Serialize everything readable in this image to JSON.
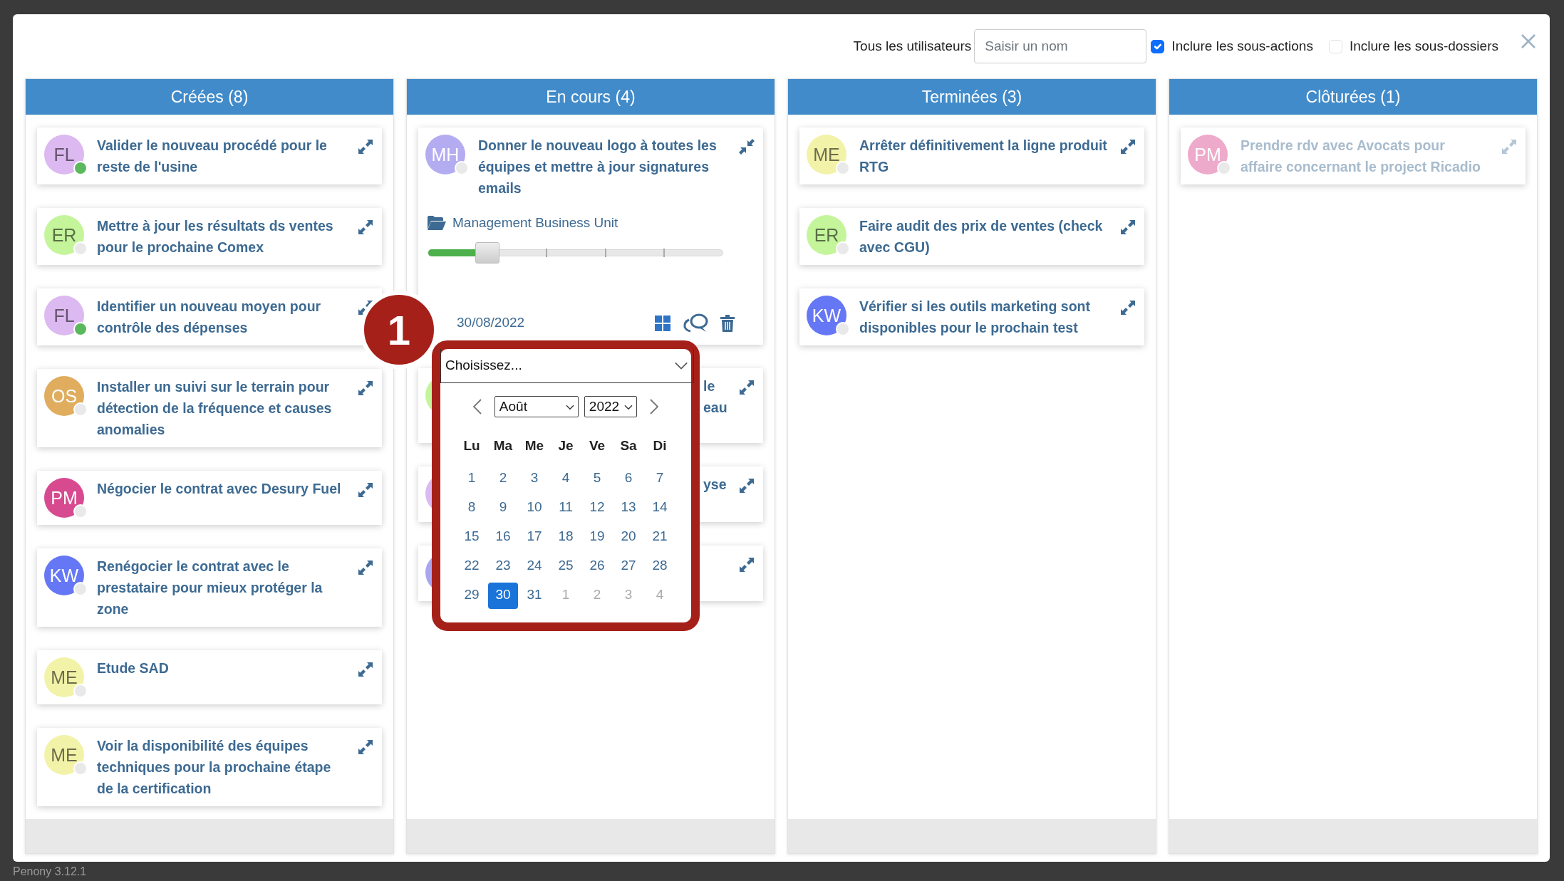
{
  "toolbar": {
    "user_label": "Tous les utilisateurs",
    "user_search": {
      "placeholder": "Saisir un nom"
    },
    "options": [
      {
        "label": "Inclure les sous-actions",
        "checked": true
      },
      {
        "label": "Inclure les sous-dossiers",
        "checked": false
      }
    ]
  },
  "columns": [
    {
      "title": "Créées (8)",
      "cards": [
        {
          "kind": "task",
          "initials": "FL",
          "color": "#dcb9f1",
          "online": true,
          "title": "Valider le nouveau procédé pour le reste de l'usine",
          "expanded": false,
          "muted": false
        },
        {
          "kind": "task",
          "initials": "ER",
          "color": "#c5f59b",
          "online": false,
          "title": "Mettre à jour les résultats ds ventes pour le prochaine Comex",
          "expanded": false,
          "muted": false
        },
        {
          "kind": "task",
          "initials": "FL",
          "color": "#dcb9f1",
          "online": true,
          "title": "Identifier un nouveau moyen pour contrôle des dépenses",
          "expanded": false,
          "muted": false
        },
        {
          "kind": "task",
          "initials": "OS",
          "color": "#dfad5d",
          "online": false,
          "title": "Installer un suivi sur le terrain pour détection de la fréquence et causes anomalies",
          "expanded": false,
          "muted": false
        },
        {
          "kind": "task",
          "initials": "PM",
          "color": "#d84a90",
          "online": false,
          "title": "Négocier le contrat avec Desury Fuel",
          "expanded": false,
          "muted": false
        },
        {
          "kind": "task",
          "initials": "KW",
          "color": "#6677f6",
          "online": false,
          "title": "Renégocier le contrat avec le prestataire pour mieux protéger la zone",
          "expanded": false,
          "muted": false
        },
        {
          "kind": "task",
          "initials": "ME",
          "color": "#f2f3a8",
          "online": false,
          "title": "Etude SAD",
          "expanded": false,
          "muted": false
        },
        {
          "kind": "task",
          "initials": "ME",
          "color": "#f2f3a8",
          "online": false,
          "title": "Voir la disponibilité des équipes techniques pour la prochaine étape de la certification",
          "expanded": false,
          "muted": false
        }
      ]
    },
    {
      "title": "En cours (4)",
      "cards": [
        {
          "kind": "task",
          "initials": "MH",
          "color": "#b3acf0",
          "online": false,
          "title": "Donner le nouveau logo à toutes les équipes et mettre à jour signatures emails",
          "expanded": true,
          "muted": false,
          "folder": "Management Business Unit",
          "progress": {
            "level": 0.2
          },
          "due_date": "30/08/2022"
        },
        {
          "kind": "covered",
          "color": "#c5f59b",
          "visible_lines": [
            "le",
            "eau"
          ],
          "expanded": false,
          "muted": false
        },
        {
          "kind": "covered",
          "color": "#dcb9f1",
          "visible_lines": [
            "yse"
          ],
          "expanded": false,
          "muted": false
        },
        {
          "kind": "covered",
          "color": "#a9a5ef",
          "expanded": false,
          "muted": false
        }
      ]
    },
    {
      "title": "Terminées (3)",
      "cards": [
        {
          "kind": "task",
          "initials": "ME",
          "color": "#f2f3a8",
          "online": false,
          "title": "Arrêter définitivement la ligne produit RTG",
          "expanded": false,
          "muted": false
        },
        {
          "kind": "task",
          "initials": "ER",
          "color": "#c5f59b",
          "online": false,
          "title": "Faire audit des prix de ventes (check avec CGU)",
          "expanded": false,
          "muted": false
        },
        {
          "kind": "task",
          "initials": "KW",
          "color": "#6677f6",
          "online": false,
          "title": "Vérifier si les outils marketing sont disponibles pour le prochain test",
          "expanded": false,
          "muted": false
        }
      ]
    },
    {
      "title": "Clôturées (1)",
      "cards": [
        {
          "kind": "task",
          "initials": "PM",
          "color": "#eeaacb",
          "online": false,
          "title": "Prendre rdv avec Avocats pour affaire concernant le project Ricadio",
          "expanded": false,
          "muted": true
        }
      ]
    }
  ],
  "callout": {
    "number": "1"
  },
  "date_picker": {
    "preset": {
      "value": "Choisissez..."
    },
    "month": "Août",
    "year": "2022",
    "weekdays": [
      "Lu",
      "Ma",
      "Me",
      "Je",
      "Ve",
      "Sa",
      "Di"
    ],
    "weeks": [
      [
        {
          "day": "1",
          "selected": false,
          "outside": false
        },
        {
          "day": "2",
          "selected": false,
          "outside": false
        },
        {
          "day": "3",
          "selected": false,
          "outside": false
        },
        {
          "day": "4",
          "selected": false,
          "outside": false
        },
        {
          "day": "5",
          "selected": false,
          "outside": false
        },
        {
          "day": "6",
          "selected": false,
          "outside": false
        },
        {
          "day": "7",
          "selected": false,
          "outside": false
        }
      ],
      [
        {
          "day": "8",
          "selected": false,
          "outside": false
        },
        {
          "day": "9",
          "selected": false,
          "outside": false
        },
        {
          "day": "10",
          "selected": false,
          "outside": false
        },
        {
          "day": "11",
          "selected": false,
          "outside": false
        },
        {
          "day": "12",
          "selected": false,
          "outside": false
        },
        {
          "day": "13",
          "selected": false,
          "outside": false
        },
        {
          "day": "14",
          "selected": false,
          "outside": false
        }
      ],
      [
        {
          "day": "15",
          "selected": false,
          "outside": false
        },
        {
          "day": "16",
          "selected": false,
          "outside": false
        },
        {
          "day": "17",
          "selected": false,
          "outside": false
        },
        {
          "day": "18",
          "selected": false,
          "outside": false
        },
        {
          "day": "19",
          "selected": false,
          "outside": false
        },
        {
          "day": "20",
          "selected": false,
          "outside": false
        },
        {
          "day": "21",
          "selected": false,
          "outside": false
        }
      ],
      [
        {
          "day": "22",
          "selected": false,
          "outside": false
        },
        {
          "day": "23",
          "selected": false,
          "outside": false
        },
        {
          "day": "24",
          "selected": false,
          "outside": false
        },
        {
          "day": "25",
          "selected": false,
          "outside": false
        },
        {
          "day": "26",
          "selected": false,
          "outside": false
        },
        {
          "day": "27",
          "selected": false,
          "outside": false
        },
        {
          "day": "28",
          "selected": false,
          "outside": false
        }
      ],
      [
        {
          "day": "29",
          "selected": false,
          "outside": false
        },
        {
          "day": "30",
          "selected": true,
          "outside": false
        },
        {
          "day": "31",
          "selected": false,
          "outside": false
        },
        {
          "day": "1",
          "selected": false,
          "outside": true
        },
        {
          "day": "2",
          "selected": false,
          "outside": true
        },
        {
          "day": "3",
          "selected": false,
          "outside": true
        },
        {
          "day": "4",
          "selected": false,
          "outside": true
        }
      ]
    ]
  },
  "app_version": "Penony 3.12.1"
}
